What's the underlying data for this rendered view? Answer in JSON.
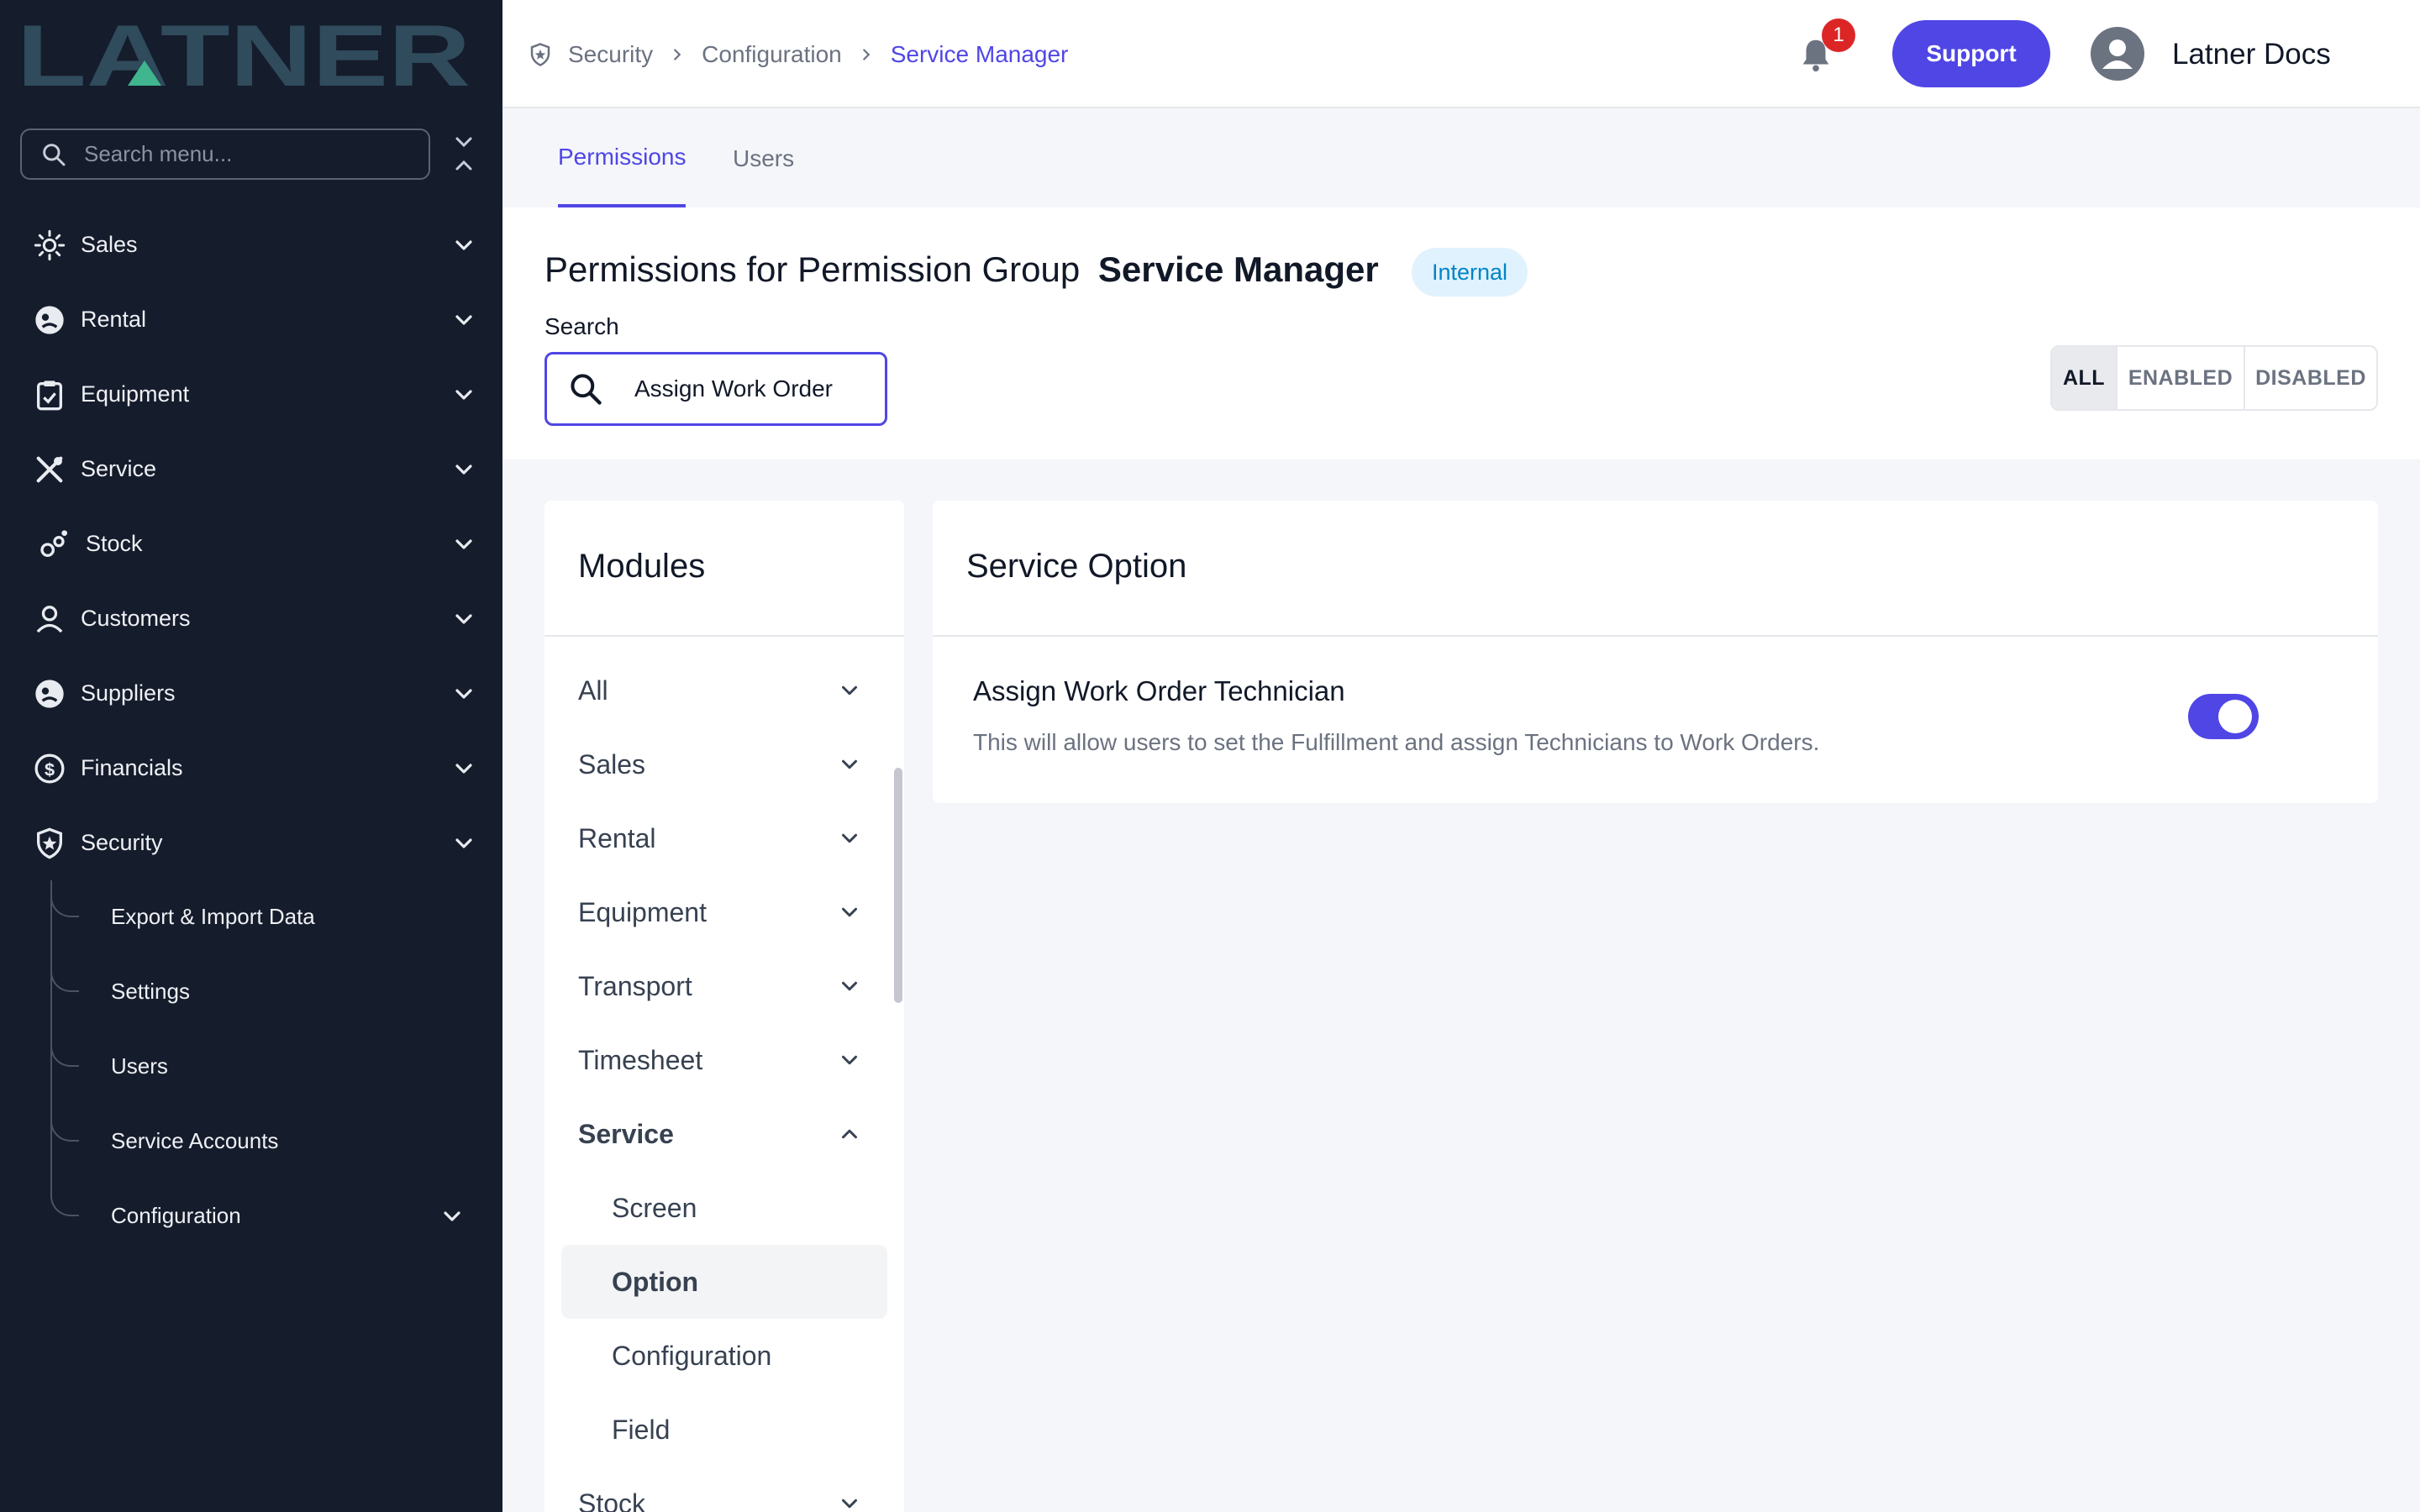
{
  "brand": {
    "logo_text": "LATNER"
  },
  "sidebar": {
    "search_placeholder": "Search menu...",
    "items": [
      {
        "label": "Sales",
        "icon": "sales-icon"
      },
      {
        "label": "Rental",
        "icon": "rental-icon"
      },
      {
        "label": "Equipment",
        "icon": "equipment-icon"
      },
      {
        "label": "Service",
        "icon": "service-icon"
      },
      {
        "label": "Stock",
        "icon": "stock-icon"
      },
      {
        "label": "Customers",
        "icon": "customers-icon"
      },
      {
        "label": "Suppliers",
        "icon": "suppliers-icon"
      },
      {
        "label": "Financials",
        "icon": "financials-icon"
      },
      {
        "label": "Security",
        "icon": "security-icon",
        "expanded": true
      }
    ],
    "security_children": [
      {
        "label": "Export & Import Data"
      },
      {
        "label": "Settings"
      },
      {
        "label": "Users"
      },
      {
        "label": "Service Accounts"
      },
      {
        "label": "Configuration"
      }
    ]
  },
  "topbar": {
    "breadcrumb": [
      "Security",
      "Configuration",
      "Service Manager"
    ],
    "notification_count": "1",
    "support_label": "Support",
    "user_name": "Latner Docs"
  },
  "tabs": [
    {
      "label": "Permissions",
      "active": true
    },
    {
      "label": "Users",
      "active": false
    }
  ],
  "header": {
    "title_prefix": "Permissions for Permission Group",
    "group_name": "Service Manager",
    "badge": "Internal",
    "search_label": "Search",
    "search_value": "Assign Work Order",
    "filters": [
      "ALL",
      "ENABLED",
      "DISABLED"
    ],
    "active_filter": "ALL"
  },
  "modules": {
    "title": "Modules",
    "items": [
      {
        "label": "All"
      },
      {
        "label": "Sales"
      },
      {
        "label": "Rental"
      },
      {
        "label": "Equipment"
      },
      {
        "label": "Transport"
      },
      {
        "label": "Timesheet"
      },
      {
        "label": "Service",
        "expanded": true
      }
    ],
    "service_children": [
      {
        "label": "Screen"
      },
      {
        "label": "Option",
        "selected": true
      },
      {
        "label": "Configuration"
      },
      {
        "label": "Field"
      }
    ],
    "after": [
      {
        "label": "Stock"
      }
    ]
  },
  "option_panel": {
    "title": "Service Option",
    "permission": {
      "name": "Assign Work Order Technician",
      "description": "This will allow users to set the Fulfillment and assign Technicians to Work Orders.",
      "enabled": true
    }
  },
  "colors": {
    "sidebar_bg": "#151c2c",
    "accent": "#4f46e5",
    "badge_bg": "#e0f2fe",
    "badge_text": "#0284c7",
    "notification": "#dc2626",
    "logo": "#2f4b5c",
    "logo_accent": "#3fb68e"
  }
}
